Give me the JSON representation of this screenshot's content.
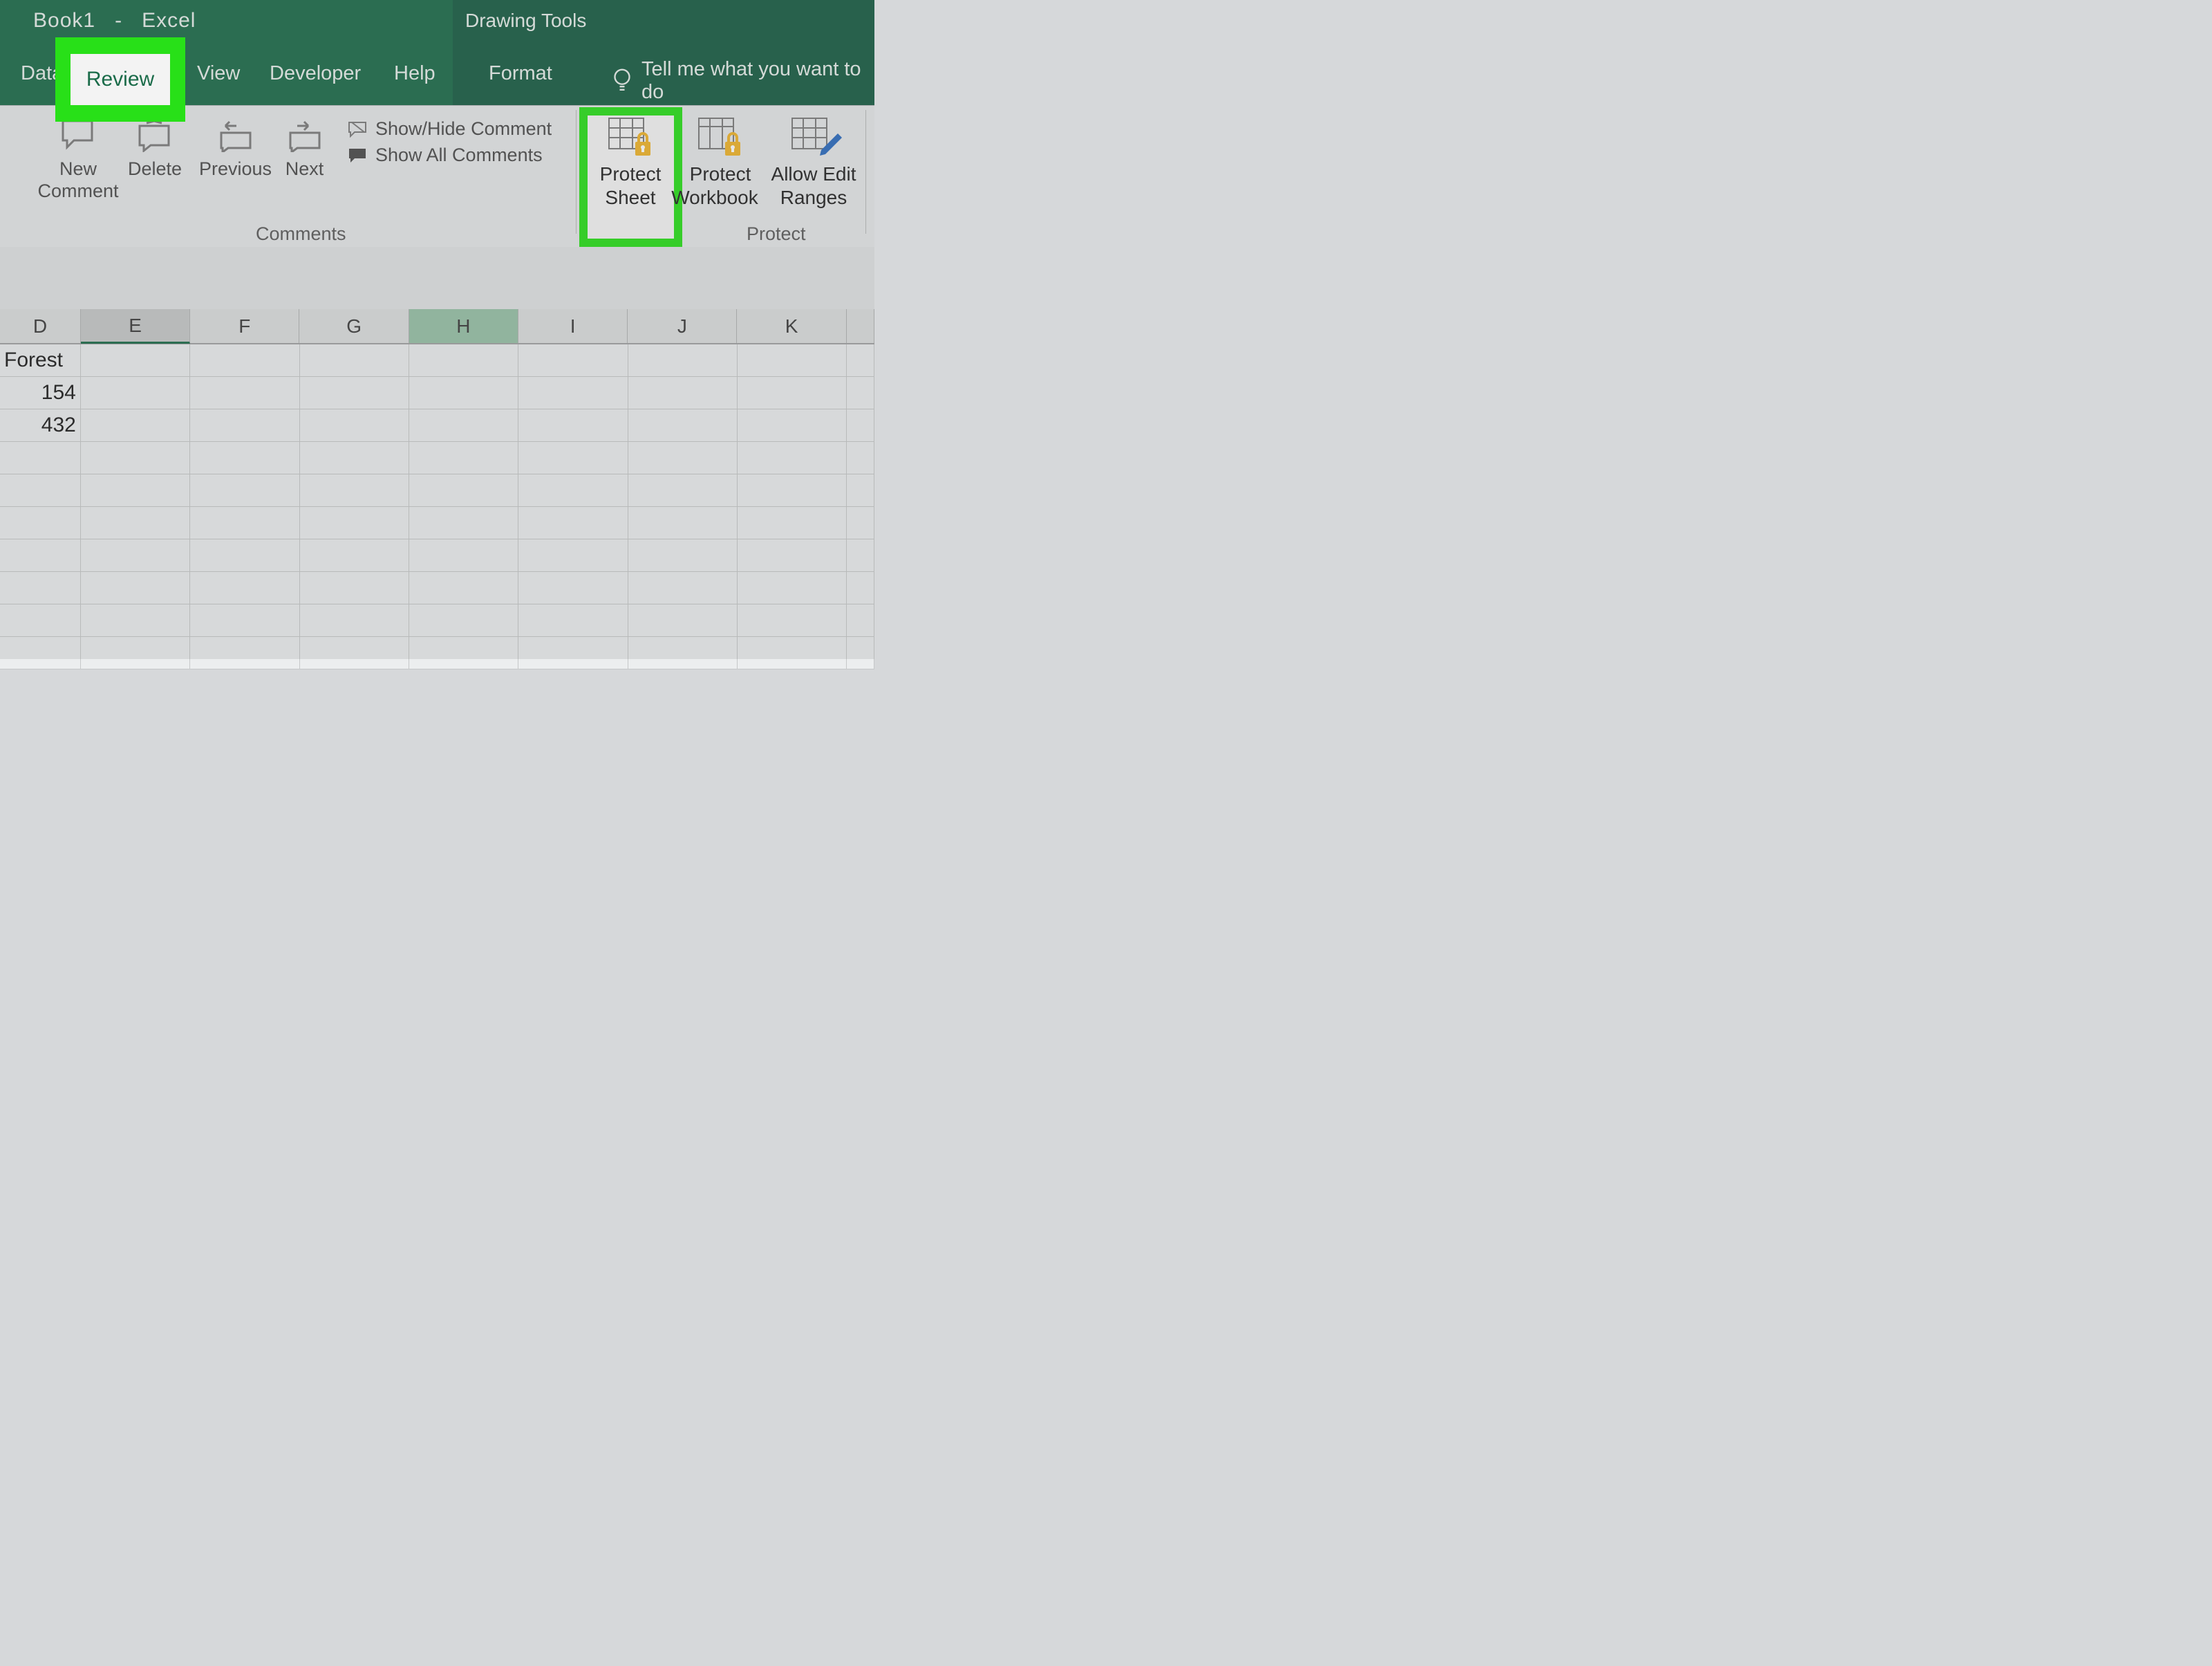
{
  "title": {
    "book": "Book1",
    "sep": "-",
    "app": "Excel",
    "context_tool": "Drawing Tools"
  },
  "tabs": {
    "data": "Data",
    "review": "Review",
    "view": "View",
    "developer": "Developer",
    "help": "Help",
    "format": "Format",
    "tell_me": "Tell me what you want to do"
  },
  "ribbon": {
    "comments": {
      "new": {
        "line1": "New",
        "line2": "Comment"
      },
      "delete": "Delete",
      "previous": "Previous",
      "next": "Next",
      "show_hide": "Show/Hide Comment",
      "show_all": "Show All Comments",
      "group_label": "Comments"
    },
    "protect": {
      "protect_sheet": {
        "line1": "Protect",
        "line2": "Sheet"
      },
      "protect_workbook": {
        "line1": "Protect",
        "line2": "Workbook"
      },
      "allow_edit": {
        "line1": "Allow Edit",
        "line2": "Ranges"
      },
      "group_label": "Protect"
    }
  },
  "columns": [
    {
      "label": "D",
      "width": 118
    },
    {
      "label": "E",
      "width": 160
    },
    {
      "label": "F",
      "width": 160
    },
    {
      "label": "G",
      "width": 160
    },
    {
      "label": "H",
      "width": 160
    },
    {
      "label": "I",
      "width": 160
    },
    {
      "label": "J",
      "width": 160
    },
    {
      "label": "K",
      "width": 160
    },
    {
      "label": "",
      "width": 40
    }
  ],
  "selected_col_index": 1,
  "active_header_col_index": 4,
  "cells": {
    "r1": {
      "D": "Forest"
    },
    "r2": {
      "D": "154"
    },
    "r3": {
      "D": "432"
    }
  },
  "num_rows": 10
}
